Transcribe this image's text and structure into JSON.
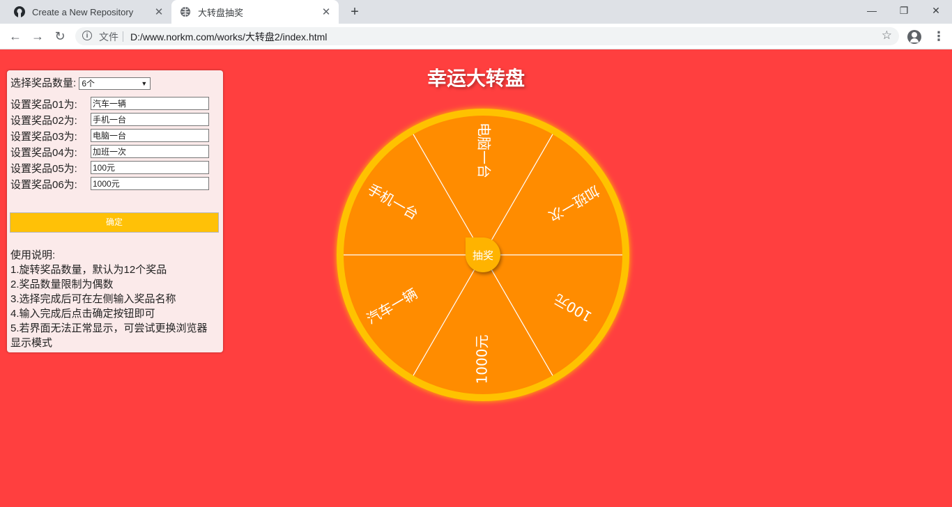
{
  "browser": {
    "tabs": [
      {
        "title": "Create a New Repository",
        "icon": "github-icon"
      },
      {
        "title": "大转盘抽奖",
        "icon": "globe-icon"
      }
    ],
    "address": {
      "scheme_label": "文件",
      "url": "D:/www.norkm.com/works/大转盘2/index.html"
    }
  },
  "panel": {
    "select_label": "选择奖品数量:",
    "select_value": "6个",
    "prizes": [
      {
        "label": "设置奖品01为:",
        "value": "汽车一辆"
      },
      {
        "label": "设置奖品02为:",
        "value": "手机一台"
      },
      {
        "label": "设置奖品03为:",
        "value": "电脑一台"
      },
      {
        "label": "设置奖品04为:",
        "value": "加班一次"
      },
      {
        "label": "设置奖品05为:",
        "value": "100元"
      },
      {
        "label": "设置奖品06为:",
        "value": "1000元"
      }
    ],
    "confirm_label": "确定",
    "instructions_title": "使用说明:",
    "instructions": [
      "1.旋转奖品数量，默认为12个奖品",
      "2.奖品数量限制为偶数",
      "3.选择完成后可在左侧输入奖品名称",
      "4.输入完成后点击确定按钮即可",
      "5.若界面无法正常显示，可尝试更换浏览器显示模式"
    ]
  },
  "wheel": {
    "title": "幸运大转盘",
    "button_label": "抽奖",
    "segments": [
      "电脑一台",
      "加班一次",
      "100元",
      "1000元",
      "汽车一辆",
      "手机一台"
    ],
    "colors": {
      "rim": "#ffc200",
      "segment": "#ff8c00",
      "divider": "#ffffff",
      "background": "#ff3f3f"
    }
  }
}
